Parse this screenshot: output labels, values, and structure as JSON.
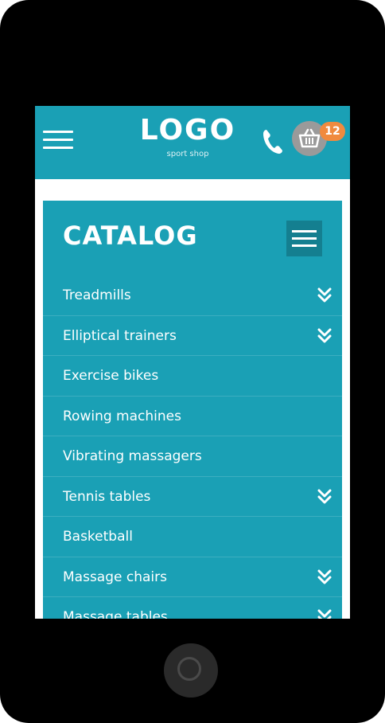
{
  "header": {
    "logo": "LOGO",
    "logo_subtitle": "sport shop",
    "cart_count": "12",
    "menu_icon": "hamburger-icon",
    "phone_icon": "phone-icon",
    "cart_icon": "basket-icon"
  },
  "catalog": {
    "title": "CATALOG",
    "items": [
      {
        "label": "Treadmills",
        "expandable": true
      },
      {
        "label": "Elliptical trainers",
        "expandable": true
      },
      {
        "label": "Exercise bikes",
        "expandable": false
      },
      {
        "label": "Rowing machines",
        "expandable": false
      },
      {
        "label": "Vibrating massagers",
        "expandable": false
      },
      {
        "label": "Tennis tables",
        "expandable": true
      },
      {
        "label": "Basketball",
        "expandable": false
      },
      {
        "label": "Massage chairs",
        "expandable": true
      },
      {
        "label": "Massage tables",
        "expandable": true
      }
    ]
  },
  "colors": {
    "accent": "#1aa0b5",
    "badge": "#f08a3e",
    "device": "#000000"
  }
}
